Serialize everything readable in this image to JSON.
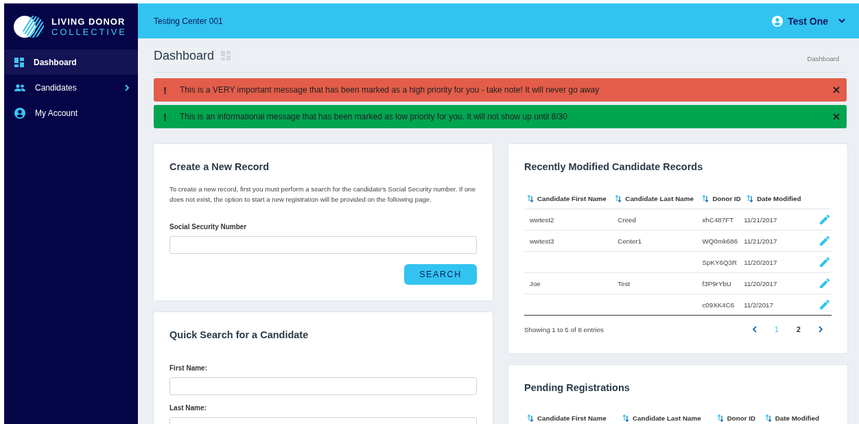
{
  "brand": {
    "line1": "LIVING DONOR",
    "line2": "COLLECTIVE"
  },
  "sidebar": {
    "items": [
      {
        "label": "Dashboard",
        "kind": "dashboard",
        "selected": true,
        "has_submenu": false
      },
      {
        "label": "Candidates",
        "kind": "people",
        "selected": false,
        "has_submenu": true
      },
      {
        "label": "My Account",
        "kind": "account",
        "selected": false,
        "has_submenu": false
      }
    ]
  },
  "topbar": {
    "center": "Testing Center 001",
    "user": "Test One"
  },
  "page": {
    "title": "Dashboard",
    "breadcrumb": "Dashboard"
  },
  "alerts": [
    {
      "kind": "danger",
      "icon": "!",
      "text": "This is a VERY important message that has been marked as a high priority for you - take note! It will never go away"
    },
    {
      "kind": "success",
      "icon": "!",
      "text": "This is an informational message that has been marked as low priority for you. It will not show up until 8/30"
    }
  ],
  "create_record": {
    "title": "Create a New Record",
    "description": "To create a new record, first you must perform a search for the candidate's Social Security number. If one does not exist, the option to start a new registration will be provided on the following page.",
    "field_label": "Social Security Number",
    "button": "SEARCH"
  },
  "quick_search": {
    "title": "Quick Search for a Candidate",
    "fields": [
      {
        "label": "First Name:"
      },
      {
        "label": "Last Name:"
      }
    ]
  },
  "recent_records": {
    "title": "Recently Modified Candidate Records",
    "columns": [
      "Candidate First Name",
      "Candidate Last Name",
      "Donor ID",
      "Date Modified"
    ],
    "rows": [
      {
        "first_name": "wwtest2",
        "last_name": "Creed",
        "donor_id": "xhC487FT",
        "date_modified": "11/21/2017"
      },
      {
        "first_name": "wwtest3",
        "last_name": "Center1",
        "donor_id": "WQ0mk686",
        "date_modified": "11/21/2017"
      },
      {
        "donor_id": "SpKY6Q3R",
        "date_modified": "11/20/2017"
      },
      {
        "first_name": "Joe",
        "last_name": "Test",
        "donor_id": "f3P9rYbU",
        "date_modified": "11/20/2017"
      },
      {
        "donor_id": "c09XK4C6",
        "date_modified": "11/2/2017"
      }
    ],
    "footer": "Showing 1 to 5 of 8 entries",
    "pages": [
      {
        "label": "1",
        "selected": true
      },
      {
        "label": "2",
        "selected": false
      }
    ]
  },
  "pending": {
    "title": "Pending Registrations",
    "columns": [
      "Candidate First Name",
      "Candidate Last Name",
      "Donor ID",
      "Date Modified"
    ]
  }
}
